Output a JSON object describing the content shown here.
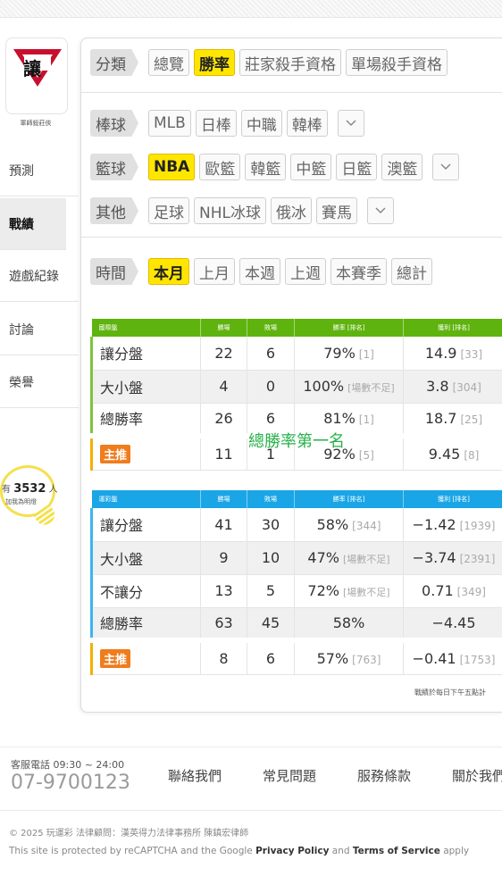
{
  "brand": {
    "logo_char": "讓",
    "tagline": "軍師殺莊俠"
  },
  "sidebar": {
    "items": [
      {
        "label": "預測"
      },
      {
        "label": "戰績"
      },
      {
        "label": "遊戲紀錄"
      },
      {
        "label": "討論"
      },
      {
        "label": "榮譽"
      }
    ],
    "followers": {
      "prefix": "有",
      "count": "3532",
      "suffix": "人",
      "caption": "加我為明燈"
    }
  },
  "filters": {
    "category": {
      "label": "分類",
      "options": [
        "總覽",
        "勝率",
        "莊家殺手資格",
        "單場殺手資格"
      ],
      "selected": "勝率"
    },
    "baseball": {
      "label": "棒球",
      "options": [
        "MLB",
        "日棒",
        "中職",
        "韓棒"
      ]
    },
    "basketball": {
      "label": "籃球",
      "options": [
        "NBA",
        "歐籃",
        "韓籃",
        "中籃",
        "日籃",
        "澳籃"
      ],
      "selected": "NBA"
    },
    "other": {
      "label": "其他",
      "options": [
        "足球",
        "NHL冰球",
        "俄冰",
        "賽馬"
      ]
    },
    "period": {
      "label": "時間",
      "options": [
        "本月",
        "上月",
        "本週",
        "上週",
        "本賽季",
        "總計"
      ],
      "selected": "本月"
    }
  },
  "intl_table": {
    "headers": [
      "國際盤",
      "勝場",
      "敗場",
      "勝率 [排名]",
      "獲利 [排名]"
    ],
    "rows": [
      {
        "name": "讓分盤",
        "wins": "22",
        "losses": "6",
        "rate": "79%",
        "rate_rank": "[1]",
        "profit": "14.9",
        "profit_rank": "[33]"
      },
      {
        "name": "大小盤",
        "wins": "4",
        "losses": "0",
        "rate": "100%",
        "rate_rank": "[場數不足]",
        "profit": "3.8",
        "profit_rank": "[304]"
      },
      {
        "name": "總勝率",
        "wins": "26",
        "losses": "6",
        "rate": "81%",
        "rate_rank": "[1]",
        "profit": "18.7",
        "profit_rank": "[25]"
      }
    ],
    "recommend": {
      "badge": "主推",
      "wins": "11",
      "losses": "1",
      "rate": "92%",
      "rate_rank": "[5]",
      "profit": "9.45",
      "profit_rank": "[8]"
    }
  },
  "overlay_text": "總勝率第一名",
  "lottery_table": {
    "headers": [
      "運彩盤",
      "勝場",
      "敗場",
      "勝率 [排名]",
      "獲利 [排名]"
    ],
    "rows": [
      {
        "name": "讓分盤",
        "wins": "41",
        "losses": "30",
        "rate": "58%",
        "rate_rank": "[344]",
        "profit": "−1.42",
        "profit_rank": "[1939]"
      },
      {
        "name": "大小盤",
        "wins": "9",
        "losses": "10",
        "rate": "47%",
        "rate_rank": "[場數不足]",
        "profit": "−3.74",
        "profit_rank": "[2391]"
      },
      {
        "name": "不讓分",
        "wins": "13",
        "losses": "5",
        "rate": "72%",
        "rate_rank": "[場數不足]",
        "profit": "0.71",
        "profit_rank": "[349]"
      },
      {
        "name": "總勝率",
        "wins": "63",
        "losses": "45",
        "rate": "58%",
        "rate_rank": "",
        "profit": "−4.45",
        "profit_rank": ""
      }
    ],
    "recommend": {
      "badge": "主推",
      "wins": "8",
      "losses": "6",
      "rate": "57%",
      "rate_rank": "[763]",
      "profit": "−0.41",
      "profit_rank": "[1753]"
    }
  },
  "update_note": "戰績於每日下午五點計",
  "footer": {
    "service_hours": "客服電話 09:30 ~ 24:00",
    "phone": "07-9700123",
    "links": [
      "聯絡我們",
      "常見問題",
      "服務條款",
      "關於我們"
    ],
    "copyright": "© 2025 玩運彩 法律顧問：漢英得力法律事務所 陳鎮宏律師",
    "captcha_prefix": "This site is protected by reCAPTCHA and the Google ",
    "privacy": "Privacy Policy",
    "and": " and ",
    "terms": "Terms of Service",
    "apply": " apply"
  },
  "colors": {
    "accent_yellow": "#ffe600",
    "intl_green": "#5fb30e",
    "lottery_blue": "#1aa6e6",
    "badge_orange": "#f07c1c",
    "overlay_green": "#27b14a"
  }
}
